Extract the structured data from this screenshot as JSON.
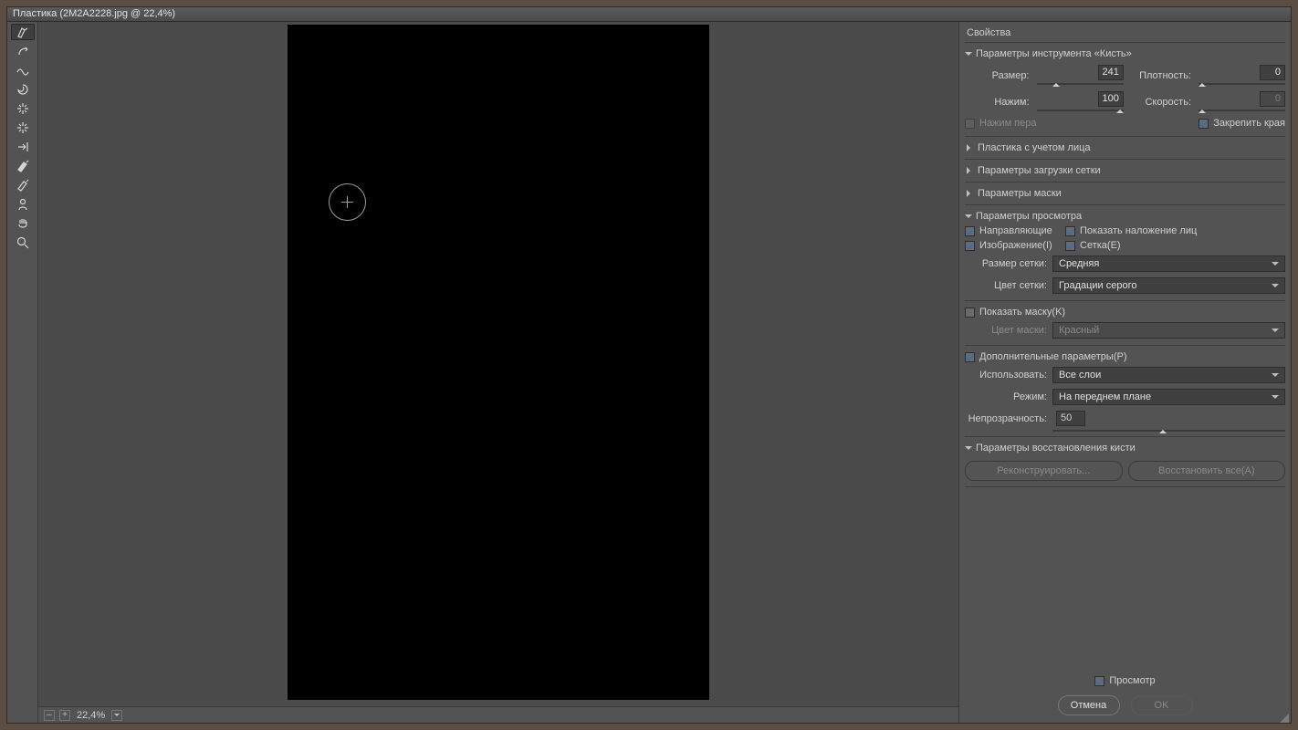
{
  "title": "Пластика (2M2A2228.jpg @ 22,4%)",
  "zoom": "22,4%",
  "panel_title": "Свойства",
  "sections": {
    "brush": {
      "title": "Параметры инструмента «Кисть»",
      "size_label": "Размер:",
      "size_value": "241",
      "density_label": "Плотность:",
      "density_value": "0",
      "pressure_label": "Нажим:",
      "pressure_value": "100",
      "rate_label": "Скорость:",
      "rate_value": "0",
      "stylus_label": "Нажим пера",
      "pin_edges_label": "Закрепить края"
    },
    "face": "Пластика с учетом лица",
    "load_mesh": "Параметры загрузки сетки",
    "mask": "Параметры маски",
    "view": {
      "title": "Параметры просмотра",
      "guides": "Направляющие",
      "face_overlay": "Показать наложение лиц",
      "image": "Изображение(I)",
      "mesh": "Сетка(E)",
      "mesh_size_label": "Размер сетки:",
      "mesh_size_value": "Средняя",
      "mesh_color_label": "Цвет сетки:",
      "mesh_color_value": "Градации серого",
      "show_mask": "Показать маску(K)",
      "mask_color_label": "Цвет маски:",
      "mask_color_value": "Красный",
      "backdrop": "Дополнительные параметры(P)",
      "use_label": "Использовать:",
      "use_value": "Все слои",
      "mode_label": "Режим:",
      "mode_value": "На переднем плане",
      "opacity_label": "Непрозрачность:",
      "opacity_value": "50"
    },
    "reconstruct": {
      "title": "Параметры восстановления кисти",
      "reconstruct_btn": "Реконструировать...",
      "restore_all_btn": "Восстановить все(A)"
    }
  },
  "preview_label": "Просмотр",
  "cancel": "Отмена",
  "ok": "OK"
}
